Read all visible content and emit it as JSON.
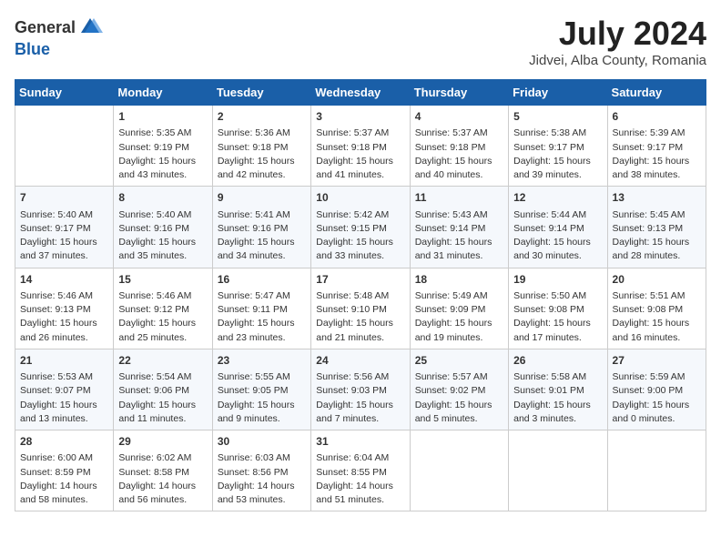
{
  "header": {
    "logo_general": "General",
    "logo_blue": "Blue",
    "title": "July 2024",
    "subtitle": "Jidvei, Alba County, Romania"
  },
  "columns": [
    "Sunday",
    "Monday",
    "Tuesday",
    "Wednesday",
    "Thursday",
    "Friday",
    "Saturday"
  ],
  "weeks": [
    [
      {
        "day": "",
        "content": ""
      },
      {
        "day": "1",
        "content": "Sunrise: 5:35 AM\nSunset: 9:19 PM\nDaylight: 15 hours\nand 43 minutes."
      },
      {
        "day": "2",
        "content": "Sunrise: 5:36 AM\nSunset: 9:18 PM\nDaylight: 15 hours\nand 42 minutes."
      },
      {
        "day": "3",
        "content": "Sunrise: 5:37 AM\nSunset: 9:18 PM\nDaylight: 15 hours\nand 41 minutes."
      },
      {
        "day": "4",
        "content": "Sunrise: 5:37 AM\nSunset: 9:18 PM\nDaylight: 15 hours\nand 40 minutes."
      },
      {
        "day": "5",
        "content": "Sunrise: 5:38 AM\nSunset: 9:17 PM\nDaylight: 15 hours\nand 39 minutes."
      },
      {
        "day": "6",
        "content": "Sunrise: 5:39 AM\nSunset: 9:17 PM\nDaylight: 15 hours\nand 38 minutes."
      }
    ],
    [
      {
        "day": "7",
        "content": "Sunrise: 5:40 AM\nSunset: 9:17 PM\nDaylight: 15 hours\nand 37 minutes."
      },
      {
        "day": "8",
        "content": "Sunrise: 5:40 AM\nSunset: 9:16 PM\nDaylight: 15 hours\nand 35 minutes."
      },
      {
        "day": "9",
        "content": "Sunrise: 5:41 AM\nSunset: 9:16 PM\nDaylight: 15 hours\nand 34 minutes."
      },
      {
        "day": "10",
        "content": "Sunrise: 5:42 AM\nSunset: 9:15 PM\nDaylight: 15 hours\nand 33 minutes."
      },
      {
        "day": "11",
        "content": "Sunrise: 5:43 AM\nSunset: 9:14 PM\nDaylight: 15 hours\nand 31 minutes."
      },
      {
        "day": "12",
        "content": "Sunrise: 5:44 AM\nSunset: 9:14 PM\nDaylight: 15 hours\nand 30 minutes."
      },
      {
        "day": "13",
        "content": "Sunrise: 5:45 AM\nSunset: 9:13 PM\nDaylight: 15 hours\nand 28 minutes."
      }
    ],
    [
      {
        "day": "14",
        "content": "Sunrise: 5:46 AM\nSunset: 9:13 PM\nDaylight: 15 hours\nand 26 minutes."
      },
      {
        "day": "15",
        "content": "Sunrise: 5:46 AM\nSunset: 9:12 PM\nDaylight: 15 hours\nand 25 minutes."
      },
      {
        "day": "16",
        "content": "Sunrise: 5:47 AM\nSunset: 9:11 PM\nDaylight: 15 hours\nand 23 minutes."
      },
      {
        "day": "17",
        "content": "Sunrise: 5:48 AM\nSunset: 9:10 PM\nDaylight: 15 hours\nand 21 minutes."
      },
      {
        "day": "18",
        "content": "Sunrise: 5:49 AM\nSunset: 9:09 PM\nDaylight: 15 hours\nand 19 minutes."
      },
      {
        "day": "19",
        "content": "Sunrise: 5:50 AM\nSunset: 9:08 PM\nDaylight: 15 hours\nand 17 minutes."
      },
      {
        "day": "20",
        "content": "Sunrise: 5:51 AM\nSunset: 9:08 PM\nDaylight: 15 hours\nand 16 minutes."
      }
    ],
    [
      {
        "day": "21",
        "content": "Sunrise: 5:53 AM\nSunset: 9:07 PM\nDaylight: 15 hours\nand 13 minutes."
      },
      {
        "day": "22",
        "content": "Sunrise: 5:54 AM\nSunset: 9:06 PM\nDaylight: 15 hours\nand 11 minutes."
      },
      {
        "day": "23",
        "content": "Sunrise: 5:55 AM\nSunset: 9:05 PM\nDaylight: 15 hours\nand 9 minutes."
      },
      {
        "day": "24",
        "content": "Sunrise: 5:56 AM\nSunset: 9:03 PM\nDaylight: 15 hours\nand 7 minutes."
      },
      {
        "day": "25",
        "content": "Sunrise: 5:57 AM\nSunset: 9:02 PM\nDaylight: 15 hours\nand 5 minutes."
      },
      {
        "day": "26",
        "content": "Sunrise: 5:58 AM\nSunset: 9:01 PM\nDaylight: 15 hours\nand 3 minutes."
      },
      {
        "day": "27",
        "content": "Sunrise: 5:59 AM\nSunset: 9:00 PM\nDaylight: 15 hours\nand 0 minutes."
      }
    ],
    [
      {
        "day": "28",
        "content": "Sunrise: 6:00 AM\nSunset: 8:59 PM\nDaylight: 14 hours\nand 58 minutes."
      },
      {
        "day": "29",
        "content": "Sunrise: 6:02 AM\nSunset: 8:58 PM\nDaylight: 14 hours\nand 56 minutes."
      },
      {
        "day": "30",
        "content": "Sunrise: 6:03 AM\nSunset: 8:56 PM\nDaylight: 14 hours\nand 53 minutes."
      },
      {
        "day": "31",
        "content": "Sunrise: 6:04 AM\nSunset: 8:55 PM\nDaylight: 14 hours\nand 51 minutes."
      },
      {
        "day": "",
        "content": ""
      },
      {
        "day": "",
        "content": ""
      },
      {
        "day": "",
        "content": ""
      }
    ]
  ]
}
